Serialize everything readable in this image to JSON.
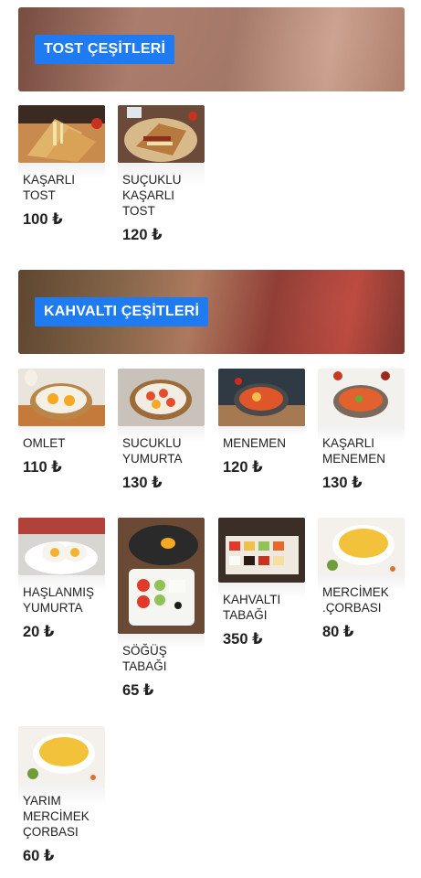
{
  "sections": [
    {
      "title": "TOST ÇEŞİTLERİ",
      "items": [
        {
          "name": "KAŞARLI TOST",
          "price": "100 ₺",
          "image": "toast-photo"
        },
        {
          "name": "SUÇUKLU KAŞARLI TOST",
          "price": "120 ₺",
          "image": "sucuk-toast-photo"
        }
      ]
    },
    {
      "title": "KAHVALTI ÇEŞİTLERİ",
      "items": [
        {
          "name": "OMLET",
          "price": "110 ₺",
          "image": "omelette-pan-photo"
        },
        {
          "name": "SUCUKLU YUMURTA",
          "price": "130 ₺",
          "image": "sucuk-egg-photo"
        },
        {
          "name": "MENEMEN",
          "price": "120 ₺",
          "image": "menemen-photo"
        },
        {
          "name": "KAŞARLI MENEMEN",
          "price": "130 ₺",
          "image": "kasarli-menemen-photo"
        },
        {
          "name": "HAŞLANMIŞ YUMURTA",
          "price": "20 ₺",
          "image": "boiled-egg-photo"
        },
        {
          "name": "SÖĞÜŞ TABAĞI",
          "price": "65 ₺",
          "image": "vegetable-plate-photo"
        },
        {
          "name": "KAHVALTI TABAĞI",
          "price": "350 ₺",
          "image": "breakfast-plate-photo"
        },
        {
          "name": "MERCİMEK .ÇORBASI",
          "price": "80 ₺",
          "image": "lentil-soup-photo"
        },
        {
          "name": "YARIM MERCİMEK ÇORBASI",
          "price": "60 ₺",
          "image": "half-lentil-soup-photo"
        }
      ]
    }
  ]
}
